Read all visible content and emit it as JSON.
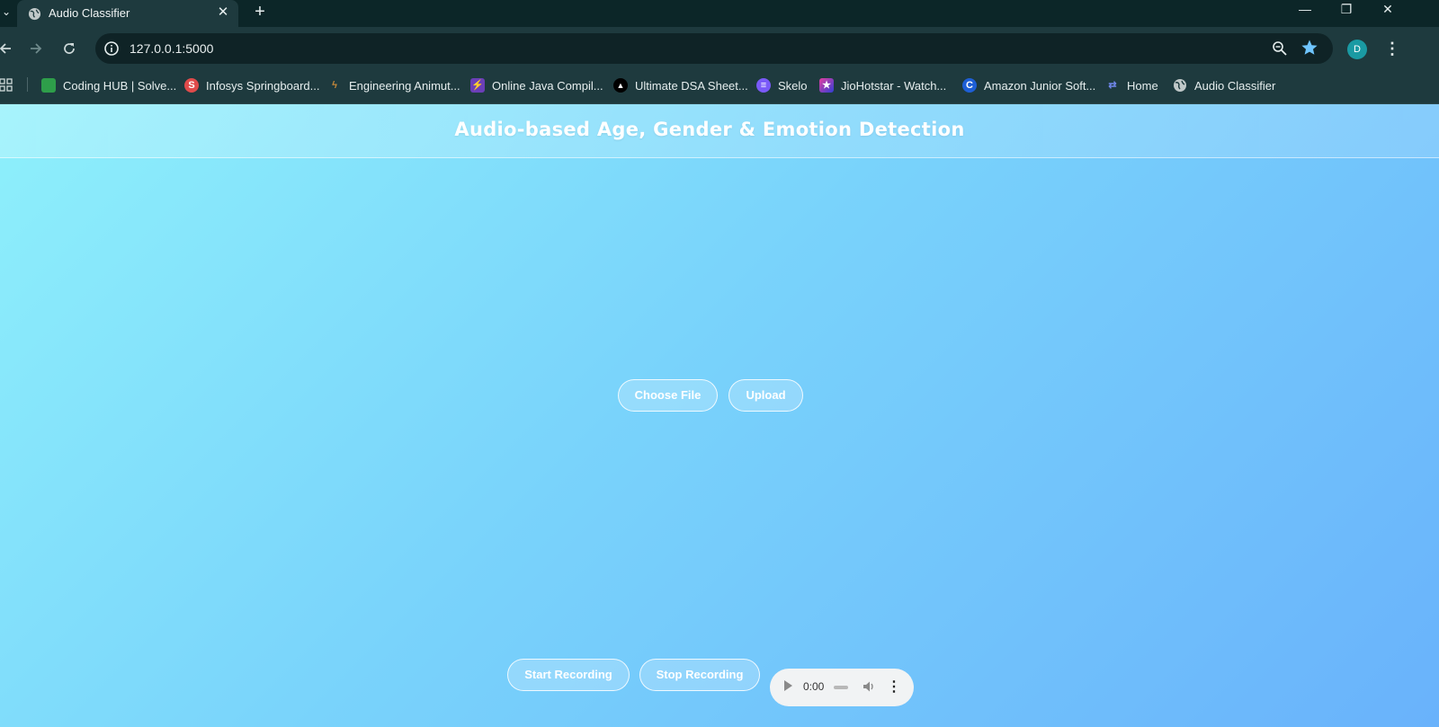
{
  "browser": {
    "tab": {
      "title": "Audio Classifier"
    },
    "controls": {
      "tab_menu": "⌄",
      "close_tab": "✕",
      "new_tab": "+",
      "minimize": "—",
      "maximize": "❐",
      "close_window": "✕"
    },
    "address_bar": {
      "url": "127.0.0.1:5000"
    },
    "profile": {
      "initial": "D",
      "color": "#1a9aa3"
    },
    "menu_glyph": "⋮",
    "bookmarks": [
      {
        "label": "Coding HUB | Solve...",
        "icon": "codinghub-icon",
        "color": "#2e9e4a"
      },
      {
        "label": "Infosys Springboard...",
        "icon": "infosys-icon",
        "color": "#e04b4b"
      },
      {
        "label": "Engineering Animut...",
        "icon": "animation-icon",
        "color": "#c88a3a"
      },
      {
        "label": "Online Java Compil...",
        "icon": "bolt-icon",
        "color": "#6b3fb8"
      },
      {
        "label": "Ultimate DSA Sheet...",
        "icon": "triangle-icon",
        "color": "#000000"
      },
      {
        "label": "Skelo",
        "icon": "skelo-icon",
        "color": "#7a5af8"
      },
      {
        "label": "JioHotstar - Watch...",
        "icon": "hotstar-icon",
        "color": "#2f3fd6"
      },
      {
        "label": "Amazon Junior Soft...",
        "icon": "c-icon",
        "color": "#1e5fd6"
      },
      {
        "label": "Home",
        "icon": "home-link-icon",
        "color": "#4f6fd8"
      },
      {
        "label": "Audio Classifier",
        "icon": "globe-icon",
        "color": "#c0c8c8"
      }
    ]
  },
  "page": {
    "title": "Audio-based Age, Gender & Emotion Detection",
    "upload": {
      "choose_file_label": "Choose File",
      "upload_label": "Upload"
    },
    "recording": {
      "start_label": "Start Recording",
      "stop_label": "Stop Recording"
    },
    "audio_player": {
      "time": "0:00",
      "more_glyph": "⋮"
    }
  }
}
